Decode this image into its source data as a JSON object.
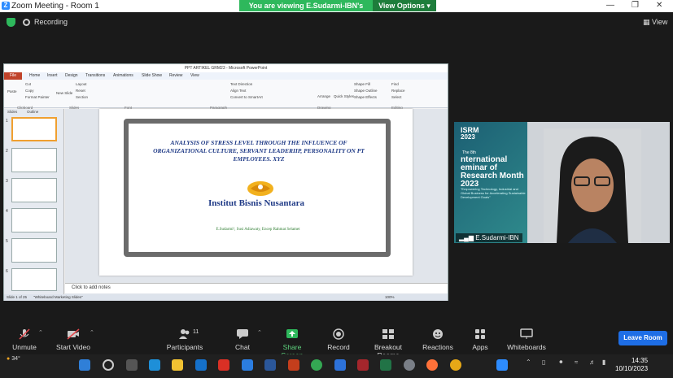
{
  "window": {
    "title": "Zoom Meeting - Room 1",
    "viewing_banner": "You are viewing E.Sudarmi-IBN's screen",
    "view_options": "View Options"
  },
  "recording": {
    "label": "Recording",
    "view_label": "View"
  },
  "ppt": {
    "window_title": "PPT ARTIKEL GRM23 - Microsoft PowerPoint",
    "tabs": [
      "File",
      "Home",
      "Insert",
      "Design",
      "Transitions",
      "Animations",
      "Slide Show",
      "Review",
      "View"
    ],
    "ribbon_labels": [
      "Cut",
      "Copy",
      "Format Painter",
      "Paste",
      "Layout",
      "Reset",
      "Section",
      "New Slide",
      "Text Direction",
      "Align Text",
      "Convert to SmartArt",
      "Arrange",
      "Quick Styles",
      "Shape Fill",
      "Shape Outline",
      "Shape Effects",
      "Find",
      "Replace",
      "Select"
    ],
    "ribbon_groups": [
      "Clipboard",
      "Slides",
      "Font",
      "Paragraph",
      "Drawing",
      "Editing"
    ],
    "panel_tabs": [
      "Slides",
      "Outline"
    ],
    "slide_numbers": [
      "1",
      "2",
      "3",
      "4",
      "5",
      "6"
    ],
    "slide_title": "ANALYSIS OF STRESS LEVEL THROUGH THE INFLUENCE OF ORGANIZATIONAL CULTURE, SERVANT LEADERIIP, PERSONALITY ON PT EMPLOYEES. XYZ",
    "institute": "Institut Bisnis Nusantara",
    "authors": "E.Sudarmi¹, Susi Adiawaty, Encep Rahmat Selamet",
    "notes_placeholder": "Click to add notes",
    "status_slide": "Slide 1 of 25",
    "status_theme": "\"Whiteboard Marketing Slides\"",
    "zoom_level": "100%"
  },
  "video": {
    "logo": "ISRM",
    "year": "2023",
    "the": "The 8th",
    "banner": "nternational eminar of Research Month 2023",
    "banner_sub": "\"Empowering Technology, Industrial and Global Business for Accelerating Sustainable Development Goals\"",
    "name": "E.Sudarmi-IBN"
  },
  "toolbar": {
    "unmute": "Unmute",
    "start_video": "Start Video",
    "participants": "Participants",
    "participant_count": "11",
    "chat": "Chat",
    "share": "Share Screen",
    "record": "Record",
    "breakout": "Breakout Rooms",
    "reactions": "Reactions",
    "apps": "Apps",
    "whiteboards": "Whiteboards",
    "leave": "Leave Room"
  },
  "taskbar": {
    "temperature": "34°",
    "time": "14:35",
    "date": "10/10/2023"
  },
  "colors": {
    "zoom_blue": "#2d8cff",
    "share_green": "#2eb85c",
    "leave_blue": "#1e6ee6",
    "ppt_red": "#c0432a",
    "slide_title": "#1f3a86"
  }
}
